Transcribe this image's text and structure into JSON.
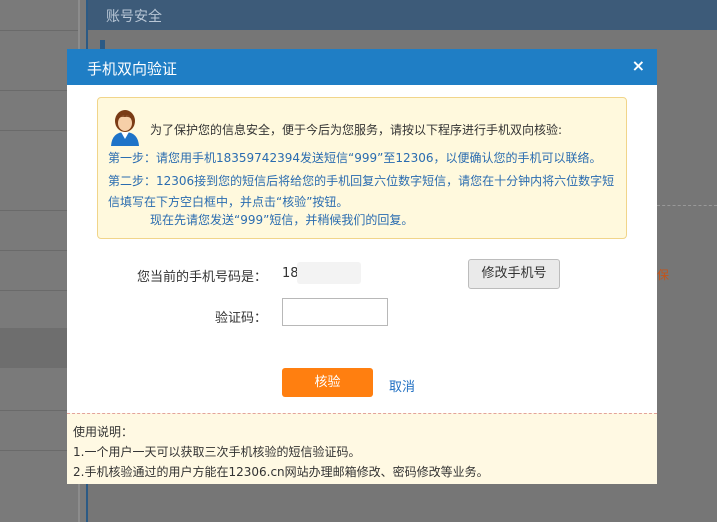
{
  "background": {
    "section_title": "账号安全",
    "orange_text": "保"
  },
  "dialog": {
    "title": "手机双向验证",
    "close_symbol": "×",
    "notice": {
      "intro": "为了保护您的信息安全，便于今后为您服务，请按以下程序进行手机双向核验:",
      "step1": "第一步：请您用手机18359742394发送短信“999”至12306，以便确认您的手机可以联络。",
      "step2": "第二步：12306接到您的短信后将给您的手机回复六位数字短信，请您在十分钟内将六位数字短信填写在下方空白框中，并点击“核验”按钮。",
      "wait": "现在先请您发送“999”短信，并稍候我们的回复。"
    },
    "phone_label": "您当前的手机号码是：",
    "phone_value": "18",
    "change_phone_button": "修改手机号",
    "code_label": "验证码：",
    "code_value": "",
    "verify_button": "核验",
    "cancel_link": "取消",
    "usage": {
      "title": "使用说明：",
      "item1": "1.一个用户一天可以获取三次手机核验的短信验证码。",
      "item2": "2.手机核验通过的用户方能在12306.cn网站办理邮箱修改、密码修改等业务。"
    }
  },
  "colors": {
    "title_bar": "#1f7ec5",
    "verify_button": "#ff7f10",
    "link": "#1f6fc2",
    "notice_text": "#2a6cb0"
  }
}
